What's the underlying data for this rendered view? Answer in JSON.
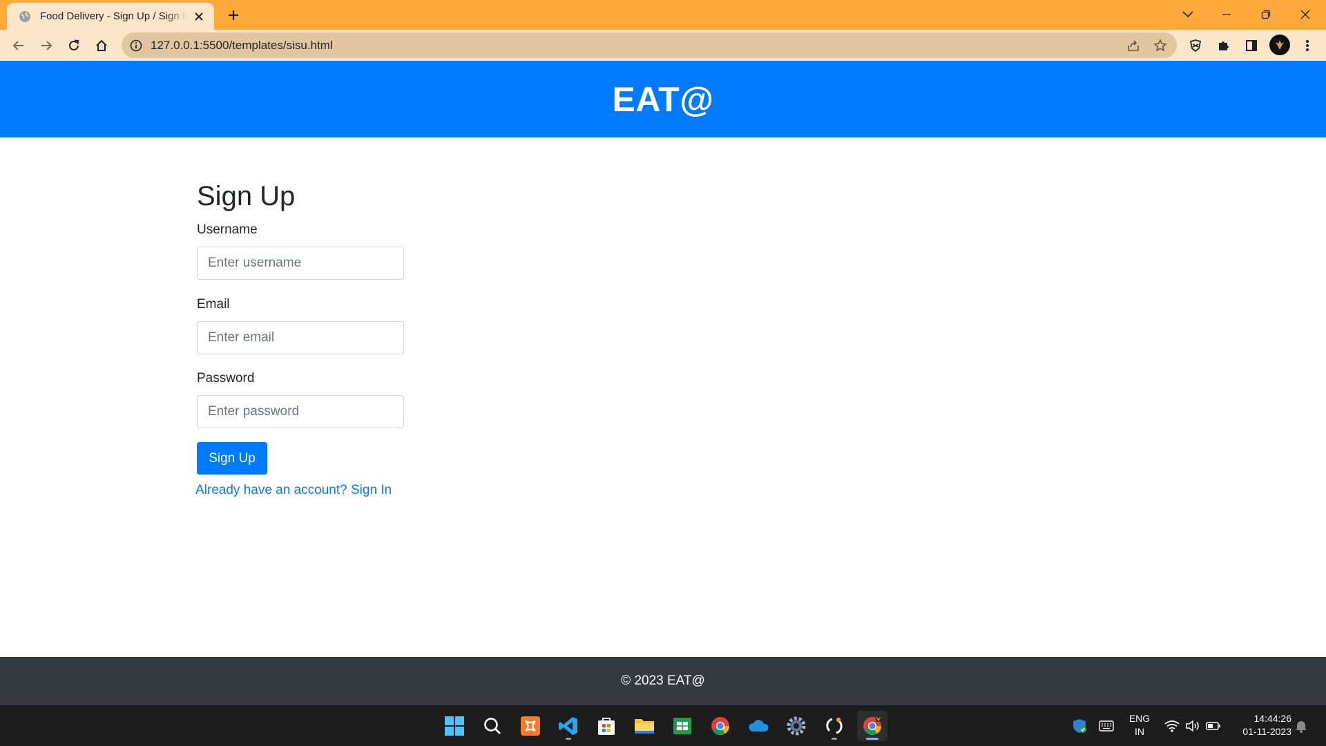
{
  "browser": {
    "tab_title": "Food Delivery - Sign Up / Sign In",
    "url": "127.0.0.1:5500/templates/sisu.html"
  },
  "header": {
    "brand": "EAT@"
  },
  "form": {
    "title": "Sign Up",
    "username_label": "Username",
    "username_placeholder": "Enter username",
    "email_label": "Email",
    "email_placeholder": "Enter email",
    "password_label": "Password",
    "password_placeholder": "Enter password",
    "submit_label": "Sign Up",
    "signin_link": "Already have an account? Sign In"
  },
  "footer": {
    "text": "© 2023 EAT@"
  },
  "taskbar": {
    "apps": [
      "start-icon",
      "search-icon",
      "xampp-icon",
      "vscode-icon",
      "store-icon",
      "file-explorer-icon",
      "sheets-icon",
      "chrome-icon",
      "onedrive-icon",
      "settings-icon",
      "github-icon",
      "chrome-profile-icon"
    ],
    "lang_line1": "ENG",
    "lang_line2": "IN",
    "time": "14:44:26",
    "date": "01-11-2023"
  },
  "colors": {
    "tabbar": "#ffa93d",
    "toolbar": "#fbe6c9",
    "primary": "#007bff",
    "footer": "#343a40",
    "taskbar": "#1c1c1c"
  }
}
